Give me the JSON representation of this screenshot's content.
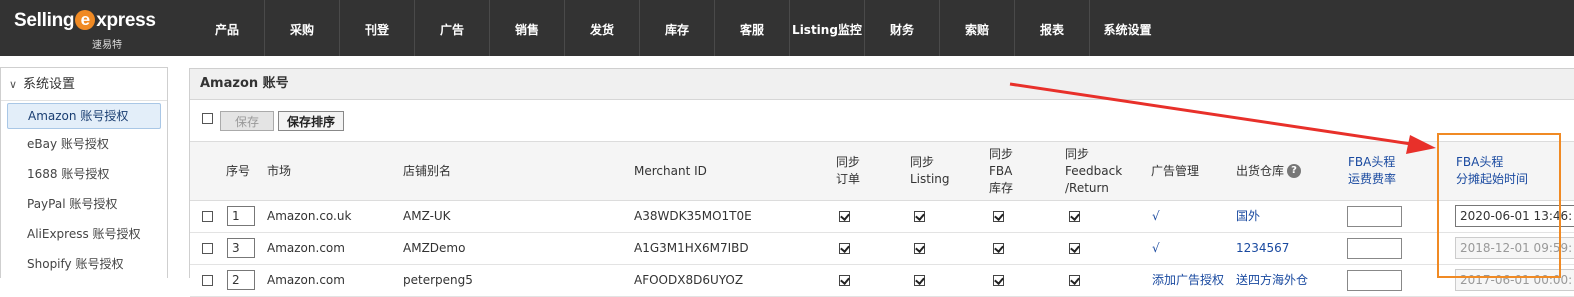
{
  "logo": {
    "brand_pre": "Selling",
    "brand_e": "e",
    "brand_post": "xpress",
    "sub": "速易特"
  },
  "nav": [
    "产品",
    "采购",
    "刊登",
    "广告",
    "销售",
    "发货",
    "库存",
    "客服",
    "Listing监控",
    "财务",
    "索赔",
    "报表",
    "系统设置"
  ],
  "sidebar": {
    "header": "系统设置",
    "items": [
      "Amazon 账号授权",
      "eBay 账号授权",
      "1688 账号授权",
      "PayPal 账号授权",
      "AliExpress 账号授权",
      "Shopify 账号授权"
    ]
  },
  "panel": {
    "title": "Amazon 账号",
    "save_label": "保存",
    "sort_label": "保存排序"
  },
  "table": {
    "headers": {
      "seq": "序号",
      "market": "市场",
      "alias": "店铺别名",
      "merchant": "Merchant ID",
      "sync_order_1": "同步",
      "sync_order_2": "订单",
      "sync_listing_1": "同步",
      "sync_listing_2": "Listing",
      "sync_fba_1": "同步",
      "sync_fba_2": "FBA",
      "sync_fba_3": "库存",
      "sync_fb_1": "同步",
      "sync_fb_2": "Feedback",
      "sync_fb_3": "/Return",
      "ad": "广告管理",
      "warehouse": "出货仓库",
      "fba_rate_1": "FBA头程",
      "fba_rate_2": "运费费率",
      "fba_start_1": "FBA头程",
      "fba_start_2": "分摊起始时间"
    },
    "rows": [
      {
        "seq": "1",
        "market": "Amazon.co.uk",
        "alias": "AMZ-UK",
        "merchant": "A38WDK35MO1T0E",
        "ad": "√",
        "warehouse": "国外",
        "start": "2020-06-01 13:46:",
        "start_disabled": false
      },
      {
        "seq": "3",
        "market": "Amazon.com",
        "alias": "AMZDemo",
        "merchant": "A1G3M1HX6M7IBD",
        "ad": "√",
        "warehouse": "1234567",
        "start": "2018-12-01 09:59:",
        "start_disabled": true
      },
      {
        "seq": "2",
        "market": "Amazon.com",
        "alias": "peterpeng5",
        "merchant": "AFOODX8D6UYOZ",
        "ad": "添加广告授权",
        "warehouse": "送四方海外仓",
        "start": "2017-06-01 00:00:",
        "start_disabled": true
      }
    ]
  },
  "colors": {
    "topbar": "#333333",
    "accent": "#f08a24",
    "arrow": "#e8302a",
    "link": "#1a4aa0"
  }
}
